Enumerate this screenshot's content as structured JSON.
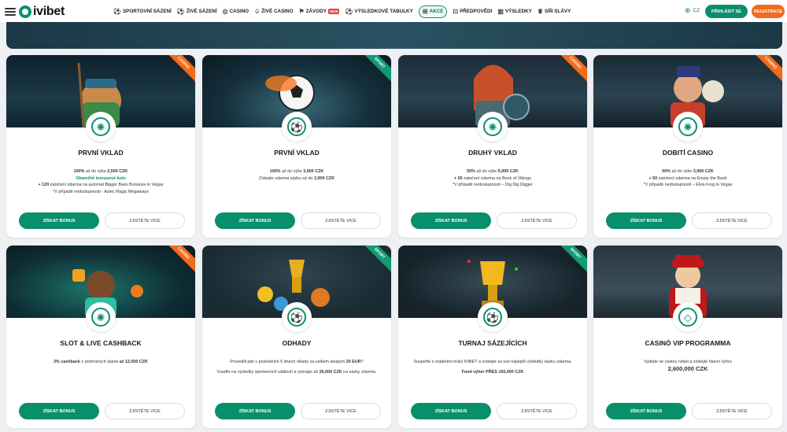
{
  "header": {
    "logo_text": "ivibet",
    "nav": [
      {
        "label": "SPORTOVNÍ SÁZENÍ",
        "icon": "soccer-ball-icon",
        "glyph": "⚽"
      },
      {
        "label": "ŽIVÉ SÁZENÍ",
        "icon": "live-icon",
        "glyph": "⚽"
      },
      {
        "label": "CASINO",
        "icon": "casino-chip-icon",
        "glyph": "◎"
      },
      {
        "label": "ŽIVÉ CASINO",
        "icon": "live-casino-icon",
        "glyph": "♤"
      },
      {
        "label": "ZÁVODY",
        "icon": "race-flag-icon",
        "glyph": "⚑"
      },
      {
        "label": "VÝSLEDKOVÉ TABULKY",
        "icon": "leaderboard-icon",
        "glyph": "⚽"
      },
      {
        "label": "AKCE",
        "icon": "gift-icon",
        "glyph": "⊞"
      },
      {
        "label": "PŘEDPOVĚDI",
        "icon": "predictions-icon",
        "glyph": "⊡"
      },
      {
        "label": "VÝSLEDKY",
        "icon": "results-icon",
        "glyph": "▥"
      },
      {
        "label": "SÍŇ SLÁVY",
        "icon": "trophy-icon",
        "glyph": "♛"
      }
    ],
    "nav_new_badge": "NEW",
    "lang": "CZ",
    "login_label": "PŘIHLÁSIT SE",
    "register_label": "REGISTRACE"
  },
  "cards": [
    {
      "tag": "CASINO",
      "title": "PRVNÍ VKLAD",
      "lines": [
        {
          "bold": "100%",
          "text": " až do výše ",
          "bold2": "2,500 CZK"
        },
        {
          "green": "Okamžité bonusové kolo"
        },
        {
          "bold": "+ 120",
          "text": " zatočení zdarma na automat Bigger Bass Bonanza in Vegas"
        },
        {
          "text": "*V případě nedostupnosti - Aztec Magic Megaways"
        }
      ],
      "bonus_label": "ZÍSKAT BONUS",
      "more_label": "ZJISTĚTE VICE"
    },
    {
      "tag": "SPORT",
      "title": "PRVNÍ VKLAD",
      "lines": [
        {
          "bold": "100%",
          "text": " až do výše ",
          "bold2": "3,900 CZK"
        },
        {
          "text": "Získejte zdarma sázku až do ",
          "bold2": "3,900 CZK"
        }
      ],
      "bonus_label": "ZÍSKAT BONUS",
      "more_label": "ZJISTĚTE VICE"
    },
    {
      "tag": "CASINO",
      "title": "DRUHÝ VKLAD",
      "lines": [
        {
          "bold": "50%",
          "text": " až do výše ",
          "bold2": "5,000 CZK"
        },
        {
          "bold": "+ 50",
          "text": " zatočení zdarma na Book of Vikings"
        },
        {
          "text": "*V případě nedostupnosti – Dig Dig Digger"
        }
      ],
      "bonus_label": "ZÍSKAT BONUS",
      "more_label": "ZJISTĚTE VICE"
    },
    {
      "tag": "CASINO",
      "title": "DOBITÍ CASINO",
      "lines": [
        {
          "bold": "50%",
          "text": " až do výše ",
          "bold2": "3,900 CZK"
        },
        {
          "bold": "+ 50",
          "text": " zatočení zdarma na Empty the Bank"
        },
        {
          "text": "*V případě nedostupnosti – Elvis Frog in Vegas"
        }
      ],
      "bonus_label": "ZÍSKAT BONUS",
      "more_label": "ZJISTĚTE VICE"
    },
    {
      "tag": "CASINO",
      "title": "SLOT & LIVE CASHBACK",
      "lines": [
        {
          "bold": "3% cashback",
          "text": " z prohraných sázek ",
          "bold2": "až 12,000 CZK"
        }
      ],
      "bonus_label": "ZÍSKAT BONUS",
      "more_label": "ZJISTĚTE VICE"
    },
    {
      "tag": "SPORT",
      "title": "ODHADY",
      "lines": [
        {
          "text": "Provedili jste v posledních 5 dnech vklady za celkem alespoň ",
          "bold2": "20 EUR",
          "text2": "?"
        },
        {
          "text": "Vsaďte na výsledky sportovních událostí a vyhrajte až ",
          "bold2": "26,000 CZK",
          "text2": " na sázky zdarma."
        }
      ],
      "bonus_label": "ZÍSKAT BONUS",
      "more_label": "ZJISTĚTE VICE"
    },
    {
      "tag": "SPORT",
      "title": "TURNAJ SÁZEJÍCÍCH",
      "lines": [
        {
          "text": "Soupeřte s ostatními hráči IVIBET a získejte za své nejlepší výsledky sázku zdarma."
        },
        {
          "bold": "Fond výher PŘES 150,000 CZK"
        }
      ],
      "bonus_label": "ZÍSKAT BONUS",
      "more_label": "ZJISTĚTE VICE"
    },
    {
      "tag": "",
      "title": "CASINÒ VIP PROGRAMMA",
      "lines": [
        {
          "text": "Vydejte se cestou Ivibet a získejte hlavní výhru"
        },
        {
          "big": "2,600,000 CZK"
        }
      ],
      "bonus_label": "ZÍSKAT BONUS",
      "more_label": "ZJISTĚTE VICE"
    }
  ],
  "colors": {
    "brand_green": "#0a8f6c",
    "brand_orange": "#f26a1b",
    "sport_ribbon": "#129a74"
  }
}
